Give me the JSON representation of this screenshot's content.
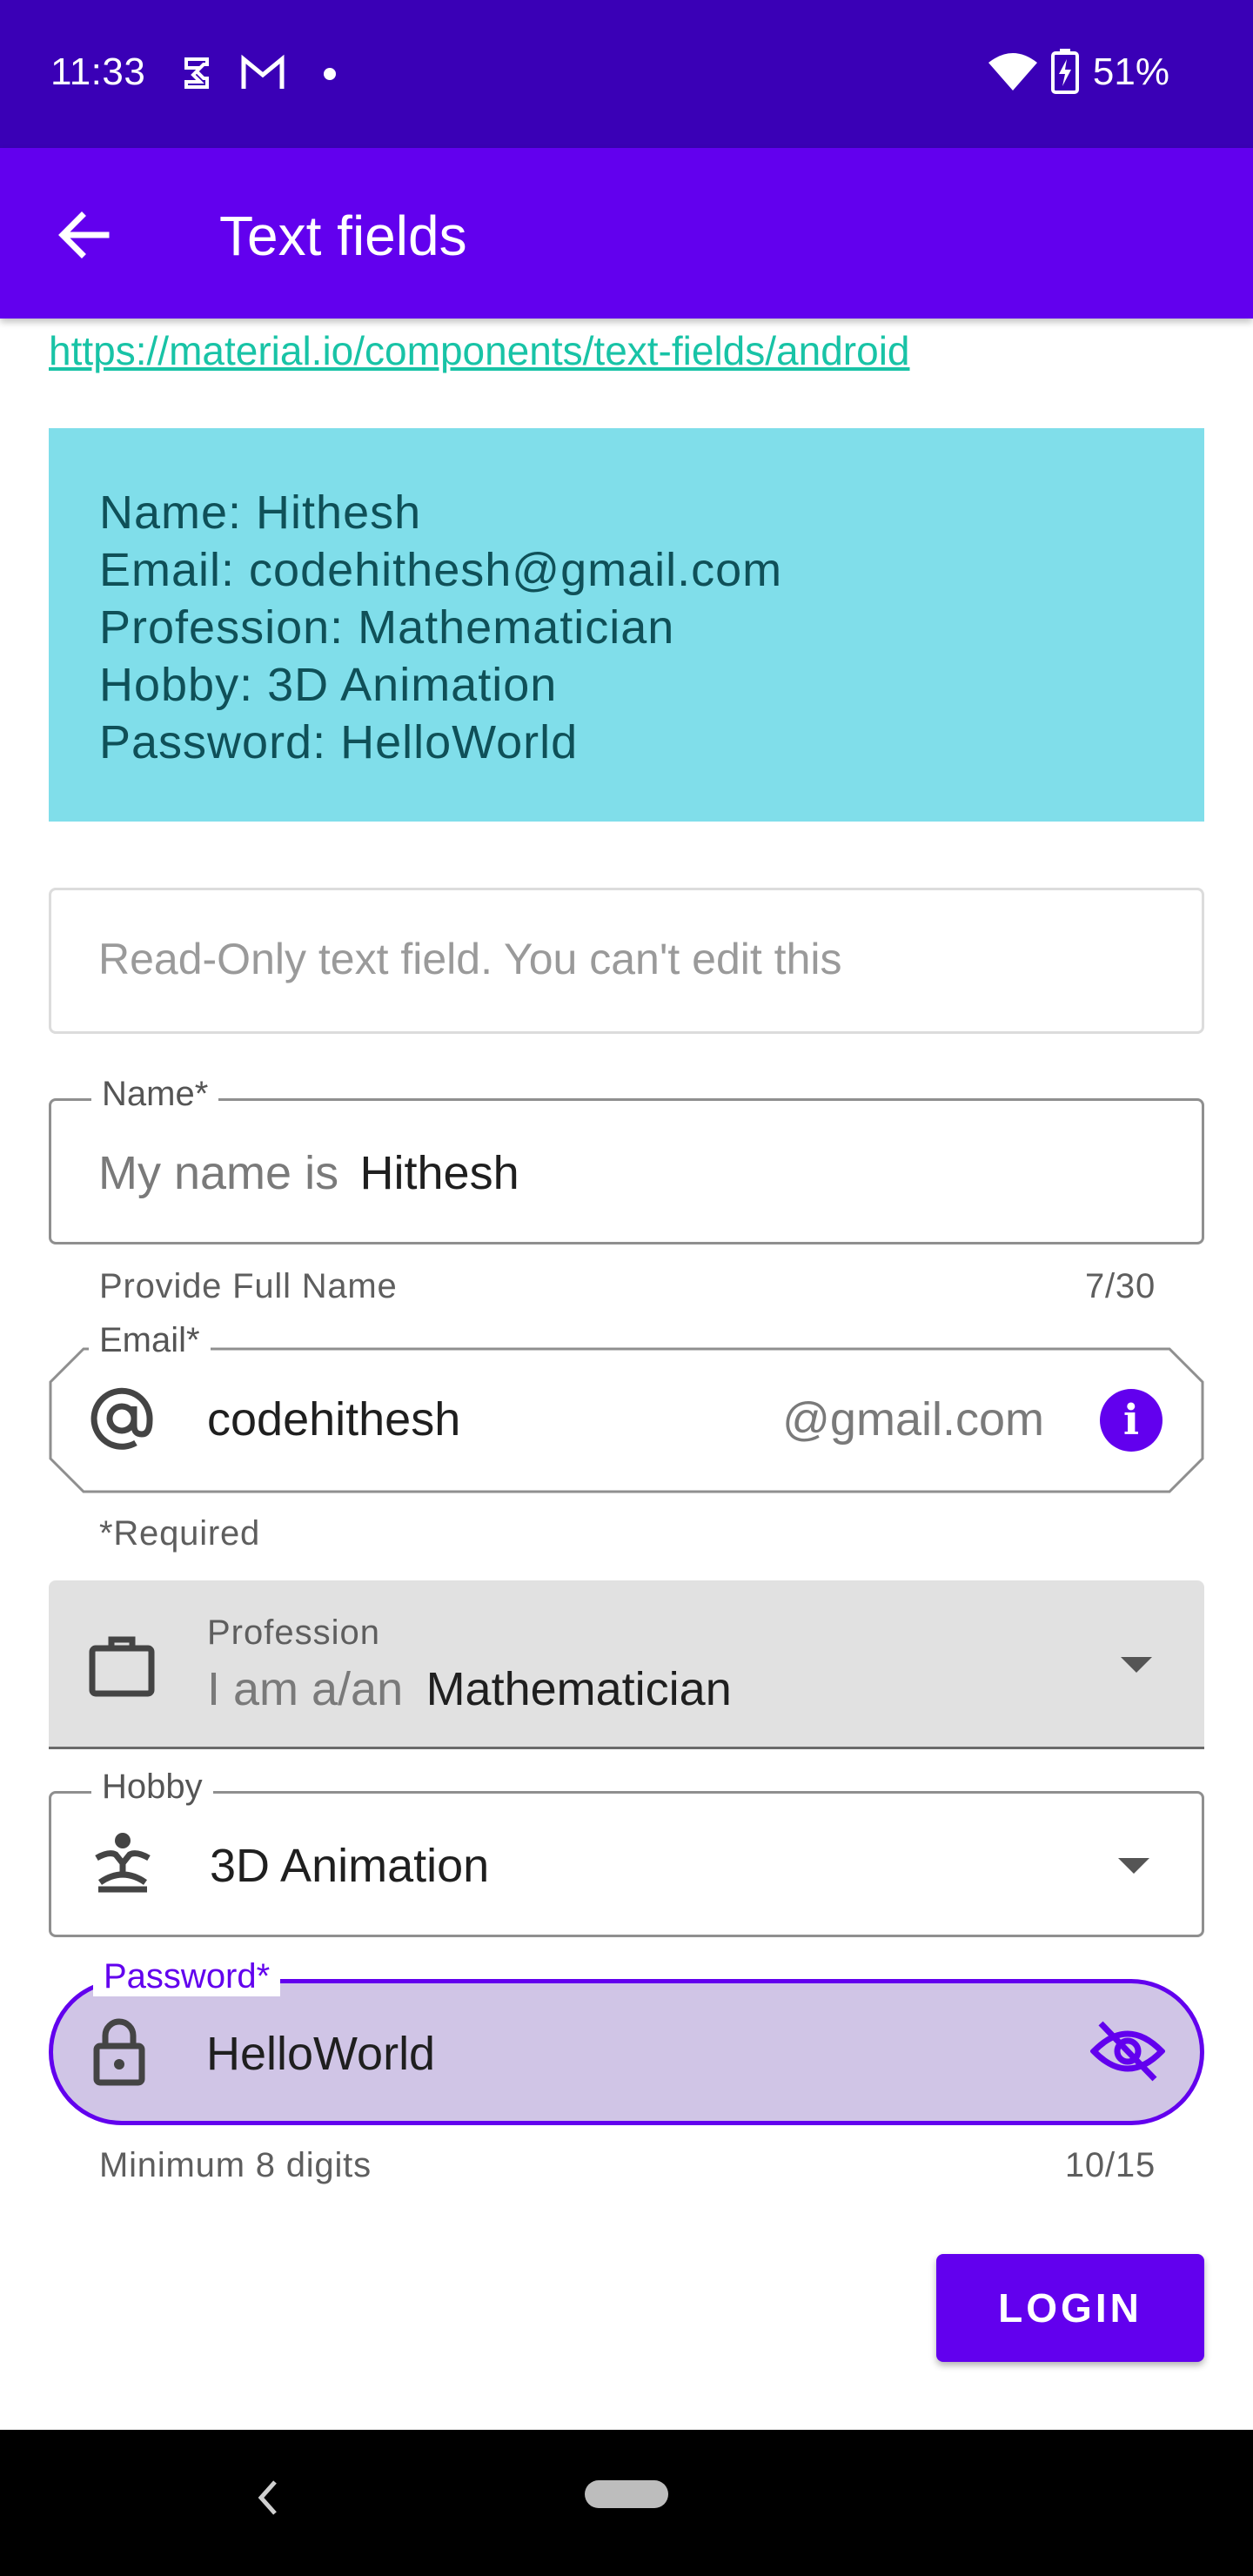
{
  "status_bar": {
    "time": "11:33",
    "battery": "51%",
    "icons": [
      "shield-icon",
      "gmail-icon",
      "notification-dot-icon",
      "wifi-icon",
      "battery-charging-icon"
    ]
  },
  "app_bar": {
    "title": "Text fields",
    "back_icon": "arrow-back-icon"
  },
  "link": "https://material.io/components/text-fields/android",
  "summary": {
    "lines": [
      "Name: Hithesh",
      "Email: codehithesh@gmail.com",
      "Profession: Mathematician",
      "Hobby: 3D Animation",
      "Password: HelloWorld"
    ]
  },
  "readonly_field": {
    "placeholder": "Read-Only text field. You can't edit this"
  },
  "name_field": {
    "label": "Name*",
    "prefix": "My name is",
    "value": "Hithesh",
    "helper": "Provide Full Name",
    "counter": "7/30"
  },
  "email_field": {
    "label": "Email*",
    "icon": "at-sign-icon",
    "value": "codehithesh",
    "suffix": "@gmail.com",
    "end_icon": "info-icon",
    "helper": "*Required"
  },
  "profession_field": {
    "label": "Profession",
    "icon": "briefcase-icon",
    "prefix": "I am a/an",
    "value": "Mathematician"
  },
  "hobby_field": {
    "label": "Hobby",
    "icon": "meditation-icon",
    "value": "3D Animation"
  },
  "password_field": {
    "label": "Password*",
    "icon": "lock-icon",
    "value": "HelloWorld",
    "end_icon": "visibility-off-icon",
    "helper": "Minimum 8 digits",
    "counter": "10/15",
    "accent": "#6200ee"
  },
  "login_button": {
    "label": "LOGIN"
  },
  "colors": {
    "status_bar": "#3a00b6",
    "primary": "#6200ee",
    "info_card": "#80deea",
    "link": "#18c3a6"
  }
}
